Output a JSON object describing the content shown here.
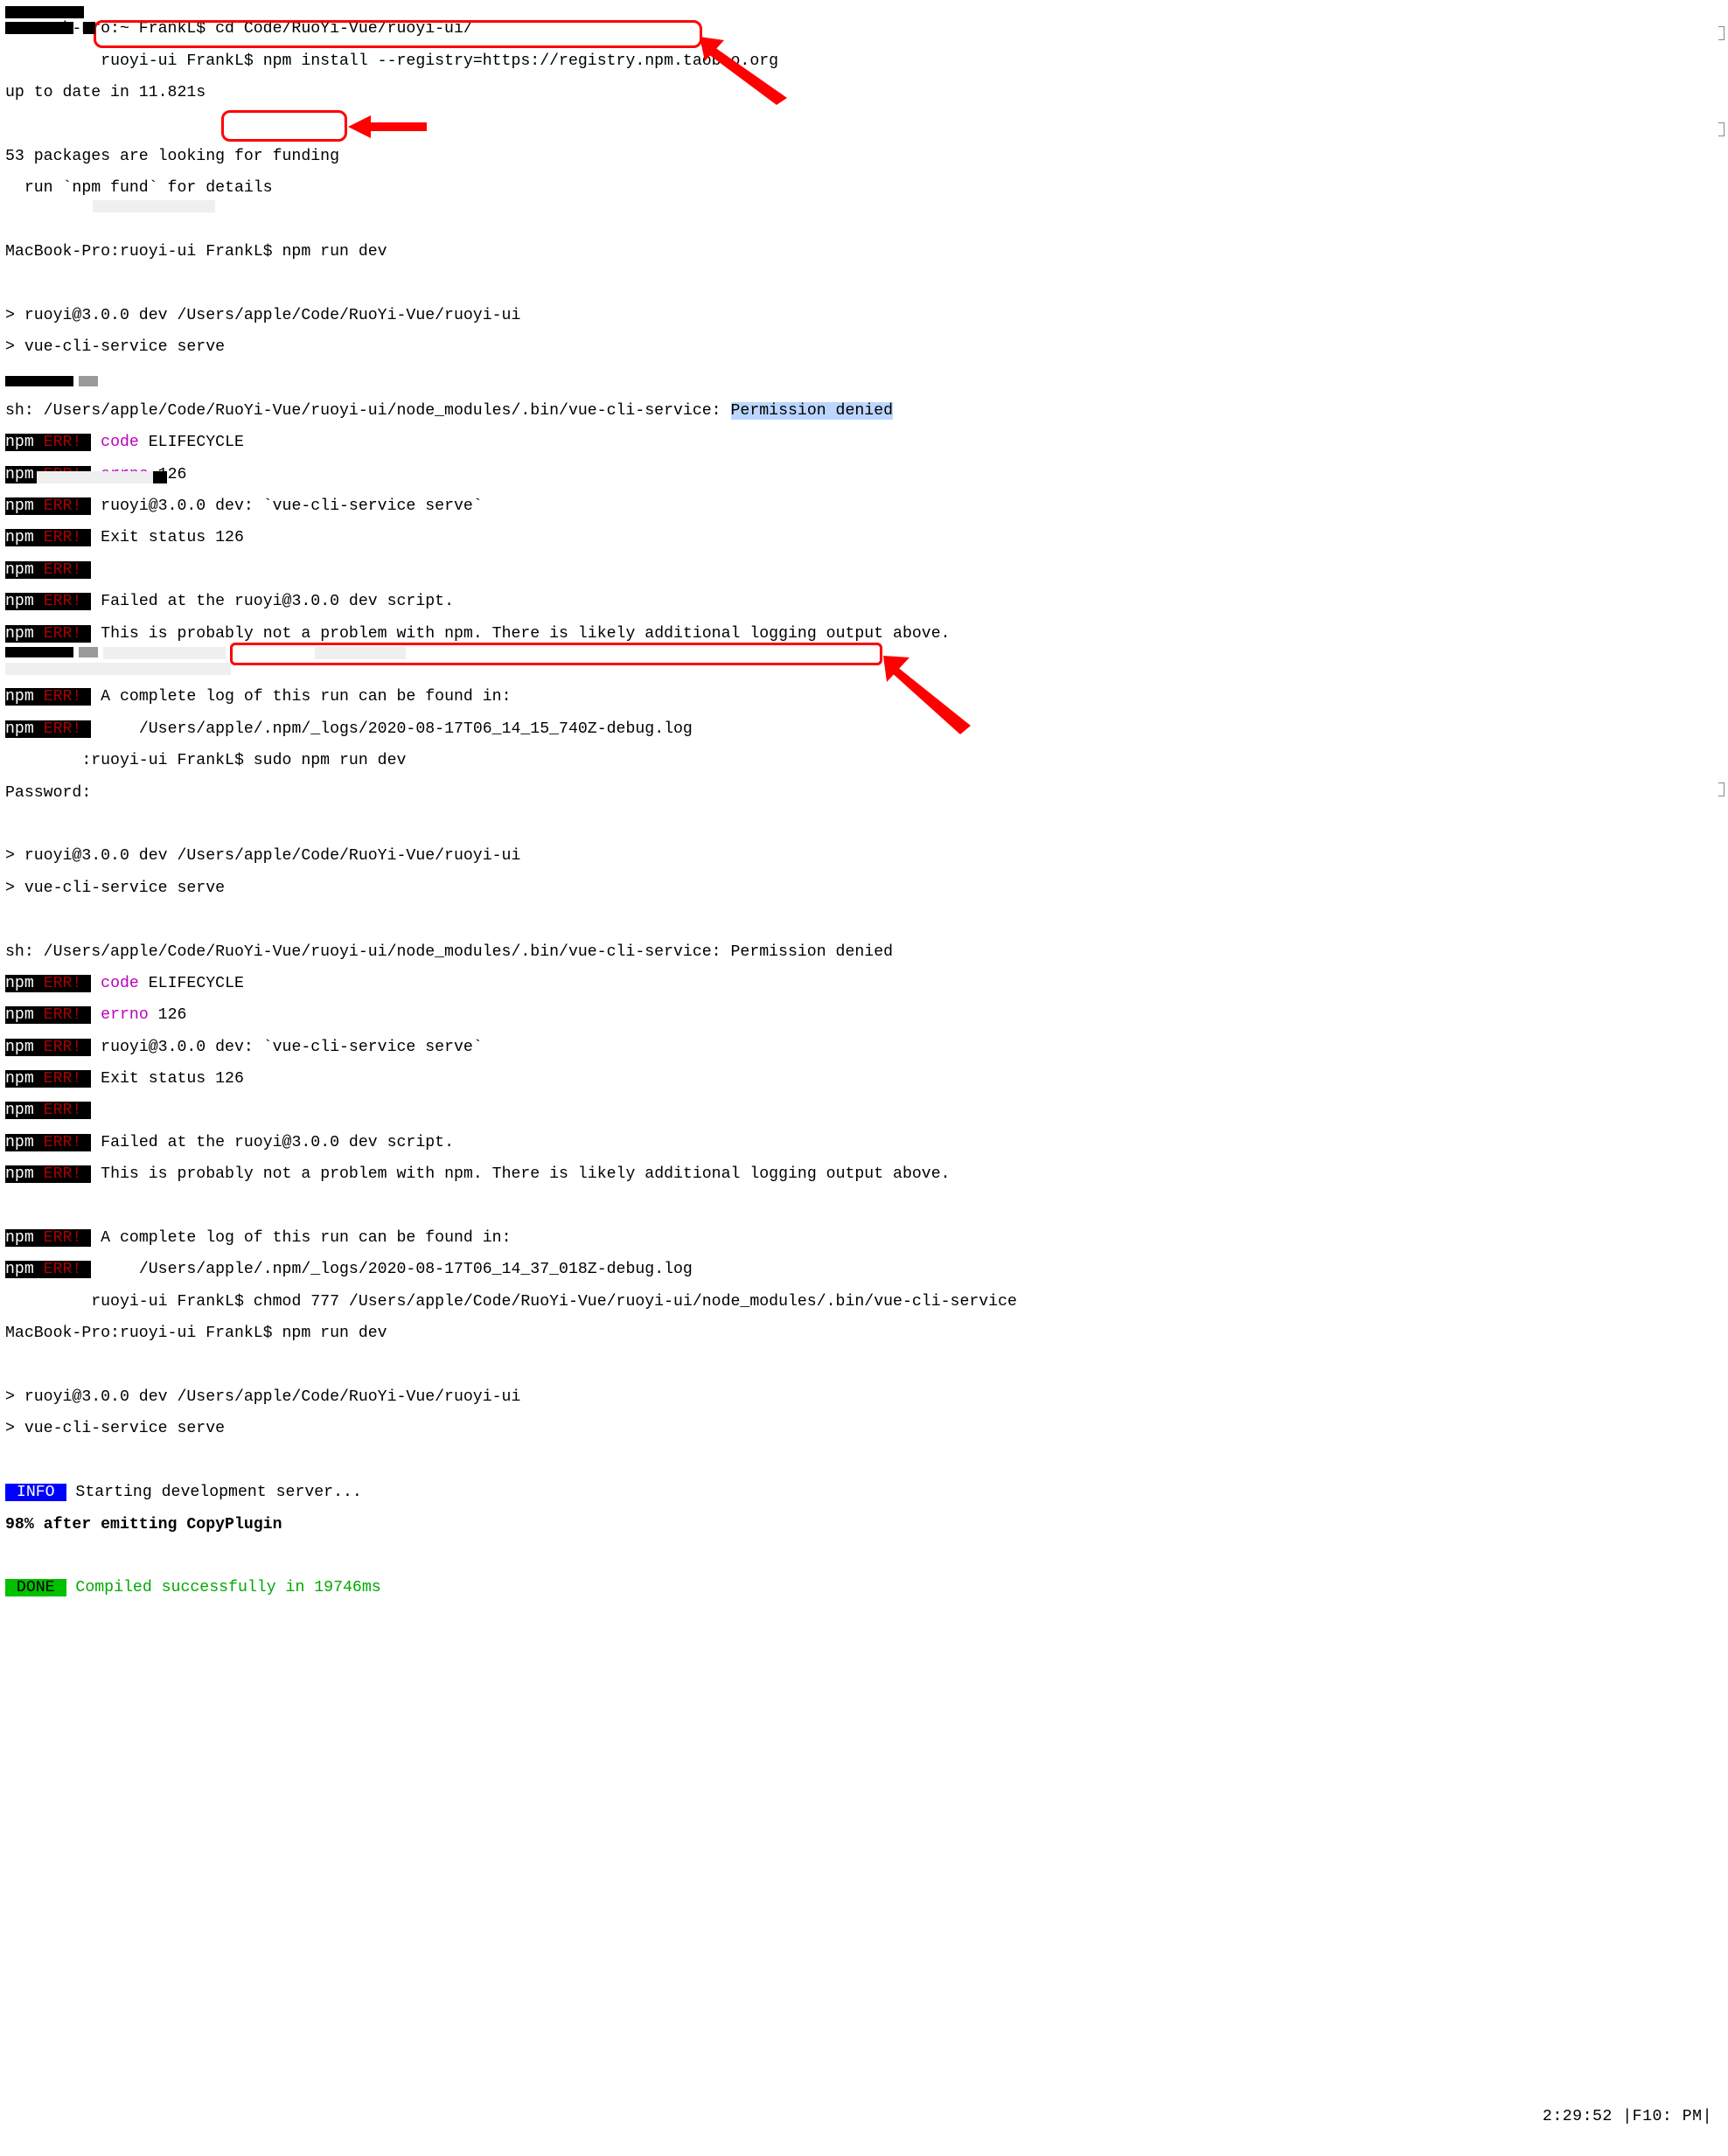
{
  "lines": {
    "l01": "MacBook-Pro:~ FrankL$ cd Code/RuoYi-Vue/ruoyi-ui/",
    "l02a": "        ",
    "l02b": "  ruoyi-ui FrankL$ npm install --registry=https://registry.npm.taobao.org",
    "l03": "up to date in 11.821s",
    "l04": "",
    "l05": "53 packages are looking for funding",
    "l06": "  run `npm fund` for details",
    "l07": "",
    "l08": "MacBook-Pro:ruoyi-ui FrankL$ npm run dev",
    "l09": "",
    "l10": "> ruoyi@3.0.0 dev /Users/apple/Code/RuoYi-Vue/ruoyi-ui",
    "l11": "> vue-cli-service serve",
    "l12": "",
    "l13a": "sh: /Users/apple/Code/RuoYi-Vue/ruoyi-ui/node_modules/.bin/vue-cli-service: ",
    "l13b": "Permission denied",
    "l14_code": "code",
    "l14_rest": " ELIFECYCLE",
    "l15_errno": "errno",
    "l15_rest": " 126",
    "l16": " ruoyi@3.0.0 dev: `vue-cli-service serve`",
    "l17": " Exit status 126",
    "l18": "",
    "l19": " Failed at the ruoyi@3.0.0 dev script.",
    "l20": " This is probably not a problem with npm. There is likely additional logging output above.",
    "l21": "",
    "l22": " A complete log of this run can be found in:",
    "l23": "     /Users/apple/.npm/_logs/2020-08-17T06_14_15_740Z-debug.log",
    "l24": "        :ruoyi-ui FrankL$ sudo npm run dev",
    "l25": "Password:",
    "l26": "",
    "l27": "> ruoyi@3.0.0 dev /Users/apple/Code/RuoYi-Vue/ruoyi-ui",
    "l28": "> vue-cli-service serve",
    "l29": "",
    "l30": "sh: /Users/apple/Code/RuoYi-Vue/ruoyi-ui/node_modules/.bin/vue-cli-service: Permission denied",
    "l31_code": "code",
    "l31_rest": " ELIFECYCLE",
    "l32_errno": "errno",
    "l32_rest": " 126",
    "l33": " ruoyi@3.0.0 dev: `vue-cli-service serve`",
    "l34": " Exit status 126",
    "l35": "",
    "l36": " Failed at the ruoyi@3.0.0 dev script.",
    "l37": " This is probably not a problem with npm. There is likely additional logging output above.",
    "l38": "",
    "l39": " A complete log of this run can be found in:",
    "l40": "     /Users/apple/.npm/_logs/2020-08-17T06_14_37_018Z-debug.log",
    "l41a": "         ruoyi-ui FrankL$ ",
    "l41b": "chmod 777 /Users/apple/Code/RuoYi-Vue/ruoyi-ui/node_modules/.bin/vue-cli-service",
    "l42": "MacBook-Pro:ruoyi-ui FrankL$ npm run dev",
    "l43": "",
    "l44": "> ruoyi@3.0.0 dev /Users/apple/Code/RuoYi-Vue/ruoyi-ui",
    "l45": "> vue-cli-service serve",
    "l46": "",
    "l47_badge": " INFO ",
    "l47_text": " Starting development server...",
    "l48": "98% after emitting CopyPlugin",
    "l49": "",
    "l50_badge": " DONE ",
    "l50_text": " Compiled successfully in 19746ms"
  },
  "npm_label": "npm",
  "err_label": " ERR! ",
  "clock": {
    "time": "2:29:52",
    "suffix": "F10: PM"
  },
  "annotations": {
    "box1": "npm-install-command-highlight",
    "box2": "npm-run-dev-highlight",
    "box3": "chmod-command-highlight"
  }
}
